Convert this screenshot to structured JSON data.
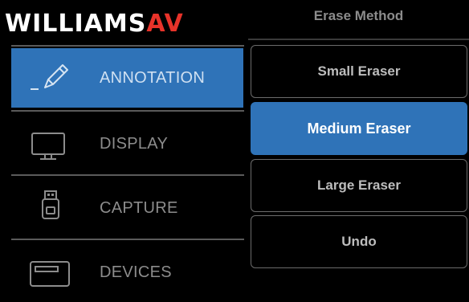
{
  "brand": {
    "part1": "WILLIAMS",
    "part2": "AV"
  },
  "nav": {
    "items": [
      {
        "label": "ANNOTATION",
        "icon": "pen-icon",
        "active": true
      },
      {
        "label": "DISPLAY",
        "icon": "monitor-icon",
        "active": false
      },
      {
        "label": "CAPTURE",
        "icon": "usb-drive-icon",
        "active": false
      },
      {
        "label": "DEVICES",
        "icon": "device-icon",
        "active": false
      }
    ]
  },
  "panel": {
    "title": "Erase Method",
    "options": [
      {
        "label": "Small Eraser",
        "selected": false
      },
      {
        "label": "Medium Eraser",
        "selected": true
      },
      {
        "label": "Large Eraser",
        "selected": false
      },
      {
        "label": "Undo",
        "selected": false
      }
    ]
  },
  "colors": {
    "accent": "#2f73b8",
    "brand_red": "#e8332a",
    "background": "#000000"
  }
}
